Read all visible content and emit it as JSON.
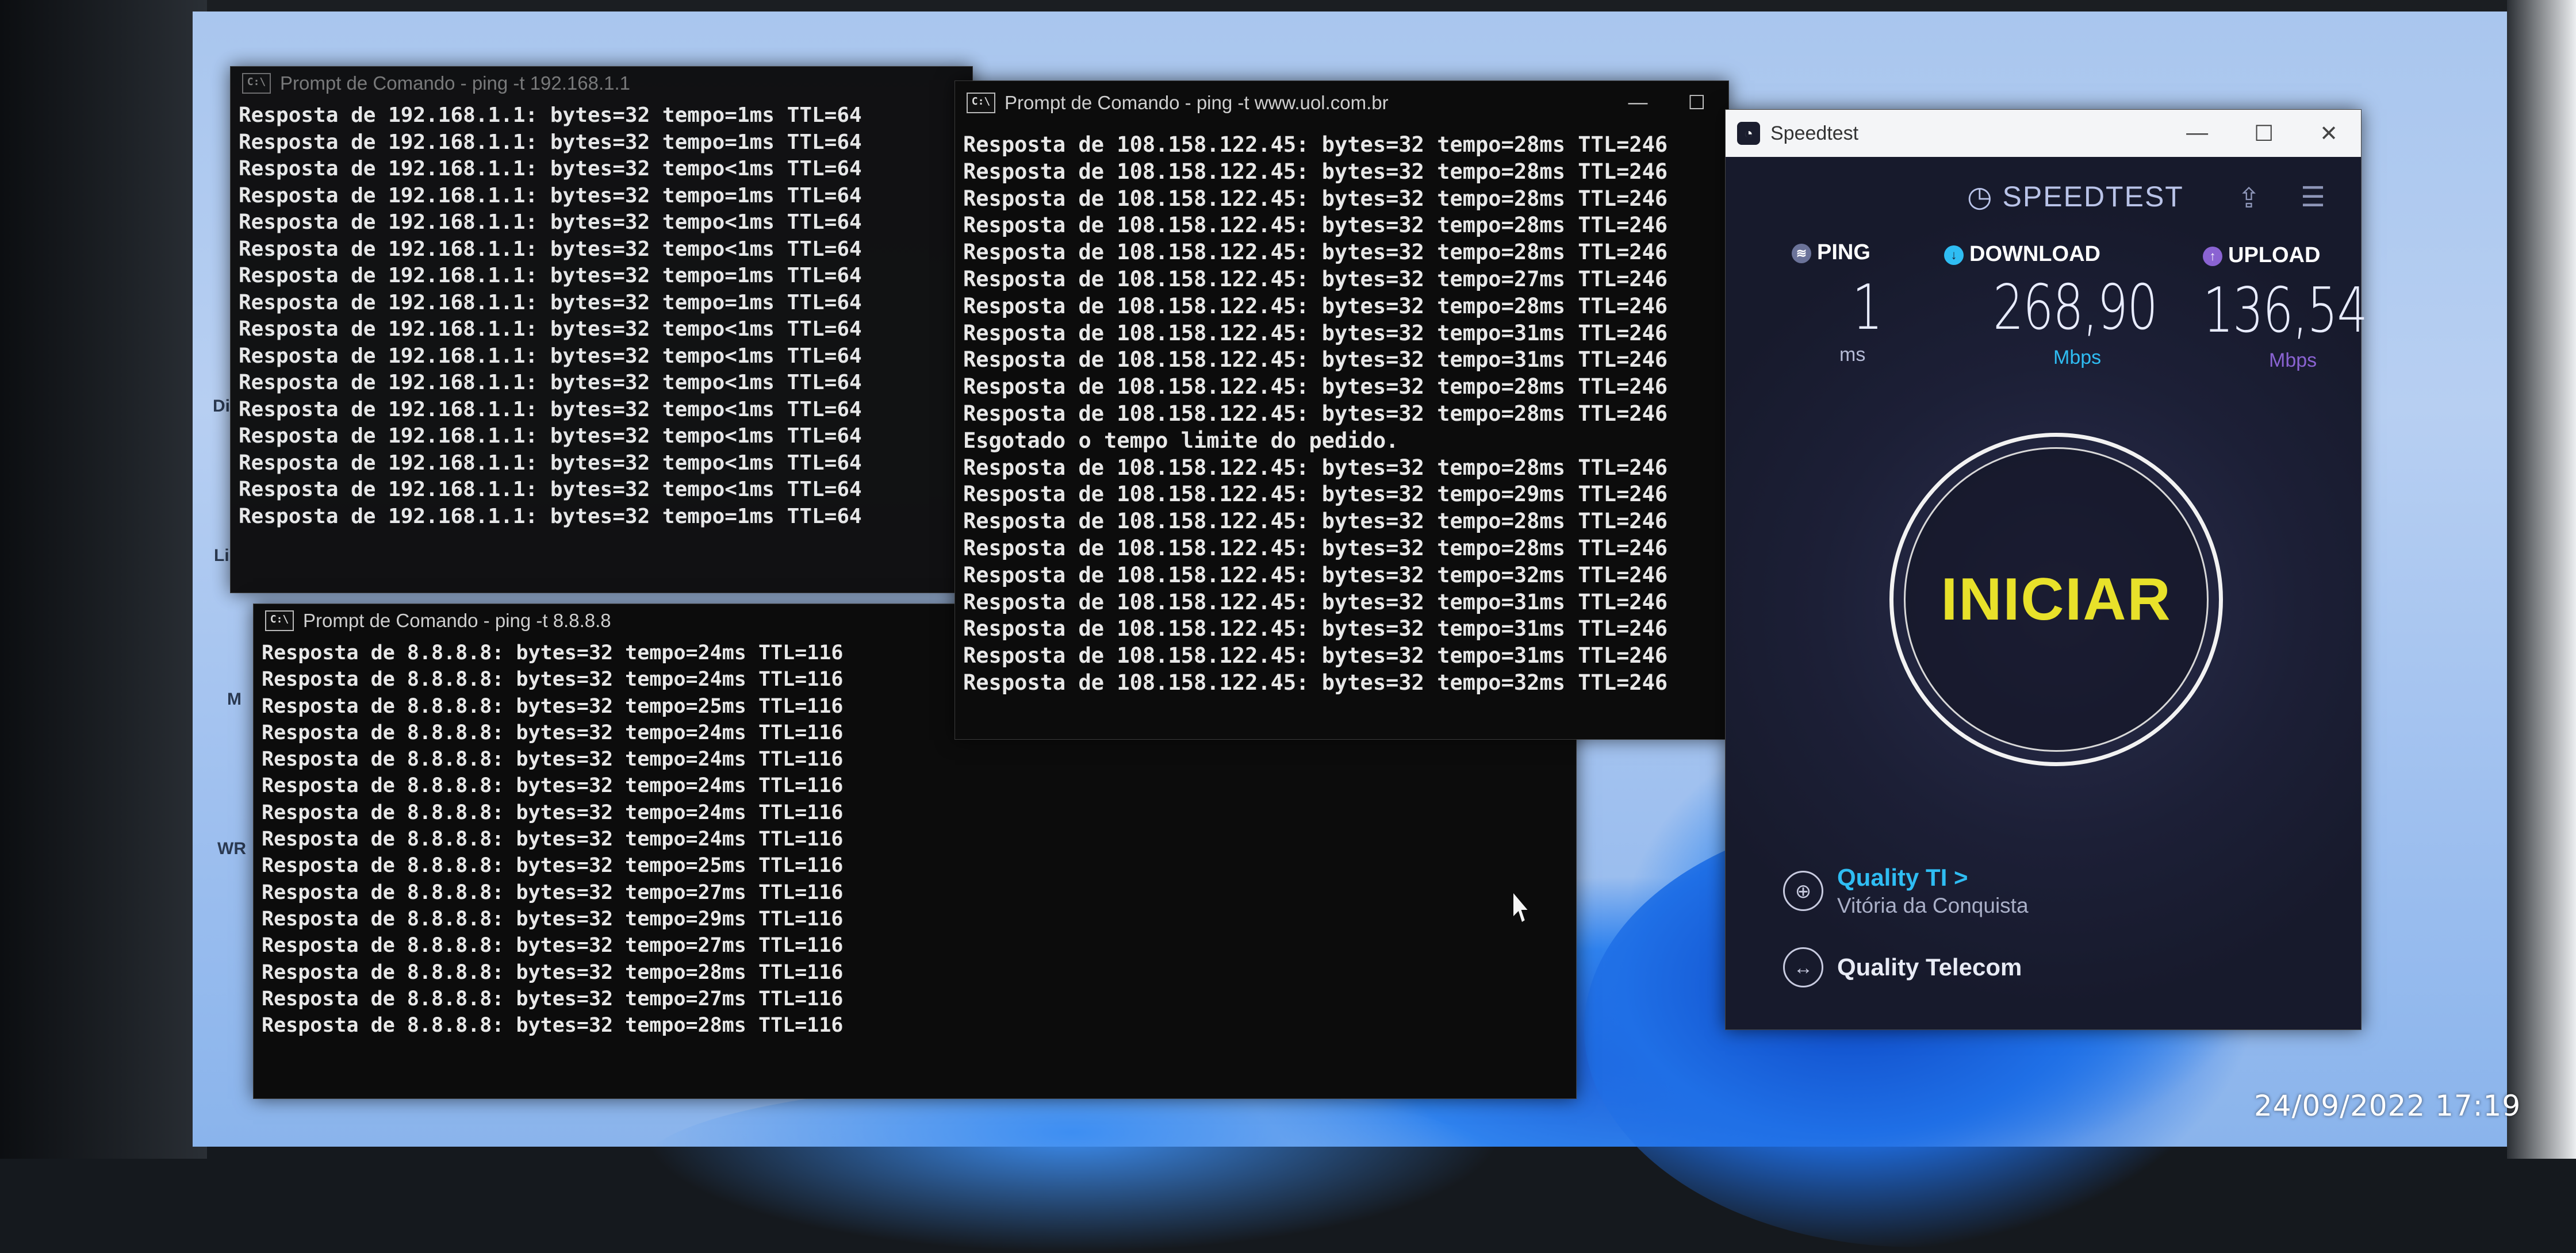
{
  "cmd1": {
    "title": "Prompt de Comando - ping  -t 192.168.1.1",
    "lines": [
      "Resposta de 192.168.1.1: bytes=32 tempo=1ms TTL=64",
      "Resposta de 192.168.1.1: bytes=32 tempo=1ms TTL=64",
      "Resposta de 192.168.1.1: bytes=32 tempo<1ms TTL=64",
      "Resposta de 192.168.1.1: bytes=32 tempo=1ms TTL=64",
      "Resposta de 192.168.1.1: bytes=32 tempo<1ms TTL=64",
      "Resposta de 192.168.1.1: bytes=32 tempo<1ms TTL=64",
      "Resposta de 192.168.1.1: bytes=32 tempo=1ms TTL=64",
      "Resposta de 192.168.1.1: bytes=32 tempo=1ms TTL=64",
      "Resposta de 192.168.1.1: bytes=32 tempo<1ms TTL=64",
      "Resposta de 192.168.1.1: bytes=32 tempo<1ms TTL=64",
      "Resposta de 192.168.1.1: bytes=32 tempo<1ms TTL=64",
      "Resposta de 192.168.1.1: bytes=32 tempo<1ms TTL=64",
      "Resposta de 192.168.1.1: bytes=32 tempo<1ms TTL=64",
      "Resposta de 192.168.1.1: bytes=32 tempo<1ms TTL=64",
      "Resposta de 192.168.1.1: bytes=32 tempo<1ms TTL=64",
      "Resposta de 192.168.1.1: bytes=32 tempo=1ms TTL=64"
    ]
  },
  "cmd2": {
    "title": "Prompt de Comando - ping  -t www.uol.com.br",
    "lines": [
      "Resposta de 108.158.122.45: bytes=32 tempo=28ms TTL=246",
      "Resposta de 108.158.122.45: bytes=32 tempo=28ms TTL=246",
      "Resposta de 108.158.122.45: bytes=32 tempo=28ms TTL=246",
      "Resposta de 108.158.122.45: bytes=32 tempo=28ms TTL=246",
      "Resposta de 108.158.122.45: bytes=32 tempo=28ms TTL=246",
      "Resposta de 108.158.122.45: bytes=32 tempo=27ms TTL=246",
      "Resposta de 108.158.122.45: bytes=32 tempo=28ms TTL=246",
      "Resposta de 108.158.122.45: bytes=32 tempo=31ms TTL=246",
      "Resposta de 108.158.122.45: bytes=32 tempo=31ms TTL=246",
      "Resposta de 108.158.122.45: bytes=32 tempo=28ms TTL=246",
      "Resposta de 108.158.122.45: bytes=32 tempo=28ms TTL=246",
      "Esgotado o tempo limite do pedido.",
      "Resposta de 108.158.122.45: bytes=32 tempo=28ms TTL=246",
      "Resposta de 108.158.122.45: bytes=32 tempo=29ms TTL=246",
      "Resposta de 108.158.122.45: bytes=32 tempo=28ms TTL=246",
      "Resposta de 108.158.122.45: bytes=32 tempo=28ms TTL=246",
      "Resposta de 108.158.122.45: bytes=32 tempo=32ms TTL=246",
      "Resposta de 108.158.122.45: bytes=32 tempo=31ms TTL=246",
      "Resposta de 108.158.122.45: bytes=32 tempo=31ms TTL=246",
      "Resposta de 108.158.122.45: bytes=32 tempo=31ms TTL=246",
      "Resposta de 108.158.122.45: bytes=32 tempo=32ms TTL=246"
    ]
  },
  "cmd3": {
    "title": "Prompt de Comando - ping  -t 8.8.8.8",
    "lines": [
      "Resposta de 8.8.8.8: bytes=32 tempo=24ms TTL=116",
      "Resposta de 8.8.8.8: bytes=32 tempo=24ms TTL=116",
      "Resposta de 8.8.8.8: bytes=32 tempo=25ms TTL=116",
      "Resposta de 8.8.8.8: bytes=32 tempo=24ms TTL=116",
      "Resposta de 8.8.8.8: bytes=32 tempo=24ms TTL=116",
      "Resposta de 8.8.8.8: bytes=32 tempo=24ms TTL=116",
      "Resposta de 8.8.8.8: bytes=32 tempo=24ms TTL=116",
      "Resposta de 8.8.8.8: bytes=32 tempo=24ms TTL=116",
      "Resposta de 8.8.8.8: bytes=32 tempo=25ms TTL=116",
      "Resposta de 8.8.8.8: bytes=32 tempo=27ms TTL=116",
      "Resposta de 8.8.8.8: bytes=32 tempo=29ms TTL=116",
      "Resposta de 8.8.8.8: bytes=32 tempo=27ms TTL=116",
      "Resposta de 8.8.8.8: bytes=32 tempo=28ms TTL=116",
      "Resposta de 8.8.8.8: bytes=32 tempo=27ms TTL=116",
      "Resposta de 8.8.8.8: bytes=32 tempo=28ms TTL=116"
    ]
  },
  "window_buttons": {
    "minimize": "—",
    "maximize": "☐",
    "close": "✕"
  },
  "cmd_icon_text": "C:\\",
  "speedtest": {
    "window_title": "Speedtest",
    "brand": "SPEEDTEST",
    "ping": {
      "label": "PING",
      "value": "1",
      "unit": "ms"
    },
    "download": {
      "label": "DOWNLOAD",
      "value": "268,90",
      "unit": "Mbps"
    },
    "upload": {
      "label": "UPLOAD",
      "value": "136,54",
      "unit": "Mbps"
    },
    "start_label": "INICIAR",
    "server": {
      "name": "Quality TI >",
      "location": "Vitória da Conquista"
    },
    "provider": {
      "name": "Quality Telecom"
    },
    "colors": {
      "accent": "#2fbdf3",
      "start_text": "#e8e12a",
      "upload_unit": "#8a63d2",
      "download_unit": "#2fbdf3"
    }
  },
  "desktop_icons": [
    "Di",
    "Li",
    "M",
    "WR"
  ],
  "photo_timestamp": "24/09/2022  17:19"
}
